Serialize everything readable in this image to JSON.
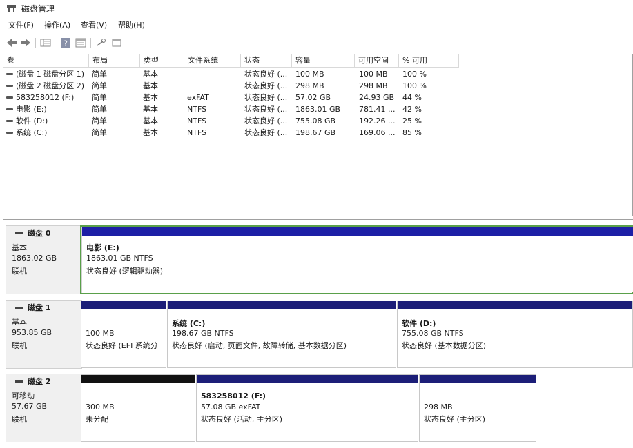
{
  "window": {
    "title": "磁盘管理",
    "minimize_label": "—"
  },
  "menu": [
    "文件(F)",
    "操作(A)",
    "查看(V)",
    "帮助(H)"
  ],
  "columns": [
    "卷",
    "布局",
    "类型",
    "文件系统",
    "状态",
    "容量",
    "可用空间",
    "% 可用"
  ],
  "volumes": [
    {
      "name": "(磁盘 1 磁盘分区 1)",
      "layout": "简单",
      "type": "基本",
      "fs": "",
      "status": "状态良好 (...",
      "capacity": "100 MB",
      "free": "100 MB",
      "pct": "100 %"
    },
    {
      "name": "(磁盘 2 磁盘分区 2)",
      "layout": "简单",
      "type": "基本",
      "fs": "",
      "status": "状态良好 (...",
      "capacity": "298 MB",
      "free": "298 MB",
      "pct": "100 %"
    },
    {
      "name": "583258012 (F:)",
      "layout": "简单",
      "type": "基本",
      "fs": "exFAT",
      "status": "状态良好 (...",
      "capacity": "57.02 GB",
      "free": "24.93 GB",
      "pct": "44 %"
    },
    {
      "name": "电影 (E:)",
      "layout": "简单",
      "type": "基本",
      "fs": "NTFS",
      "status": "状态良好 (...",
      "capacity": "1863.01 GB",
      "free": "781.41 ...",
      "pct": "42 %"
    },
    {
      "name": "软件 (D:)",
      "layout": "简单",
      "type": "基本",
      "fs": "NTFS",
      "status": "状态良好 (...",
      "capacity": "755.08 GB",
      "free": "192.26 ...",
      "pct": "25 %"
    },
    {
      "name": "系统 (C:)",
      "layout": "简单",
      "type": "基本",
      "fs": "NTFS",
      "status": "状态良好 (...",
      "capacity": "198.67 GB",
      "free": "169.06 ...",
      "pct": "85 %"
    }
  ],
  "disks": [
    {
      "name": "磁盘 0",
      "kind": "基本",
      "size": "1863.02 GB",
      "state": "联机",
      "partitions": [
        {
          "title": "电影 (E:)",
          "size": "1863.01 GB NTFS",
          "status": "状态良好 (逻辑驱动器)",
          "bar_color": "#1d1fa6"
        }
      ]
    },
    {
      "name": "磁盘 1",
      "kind": "基本",
      "size": "953.85 GB",
      "state": "联机",
      "partitions": [
        {
          "title": "",
          "size": "100 MB",
          "status": "状态良好 (EFI 系统分",
          "bar_color": "#1c1e78"
        },
        {
          "title": "系统 (C:)",
          "size": "198.67 GB NTFS",
          "status": "状态良好 (启动, 页面文件, 故障转储, 基本数据分区)",
          "bar_color": "#1c1e78"
        },
        {
          "title": "软件 (D:)",
          "size": "755.08 GB NTFS",
          "status": "状态良好 (基本数据分区)",
          "bar_color": "#1c1e78"
        }
      ]
    },
    {
      "name": "磁盘 2",
      "kind": "可移动",
      "size": "57.67 GB",
      "state": "联机",
      "partitions": [
        {
          "title": "",
          "size": "300 MB",
          "status": "未分配",
          "bar_color": "#111111"
        },
        {
          "title": "583258012 (F:)",
          "size": "57.08 GB exFAT",
          "status": "状态良好 (活动, 主分区)",
          "bar_color": "#1c1e78"
        },
        {
          "title": "",
          "size": "298 MB",
          "status": "状态良好 (主分区)",
          "bar_color": "#1c1e78"
        }
      ]
    }
  ]
}
